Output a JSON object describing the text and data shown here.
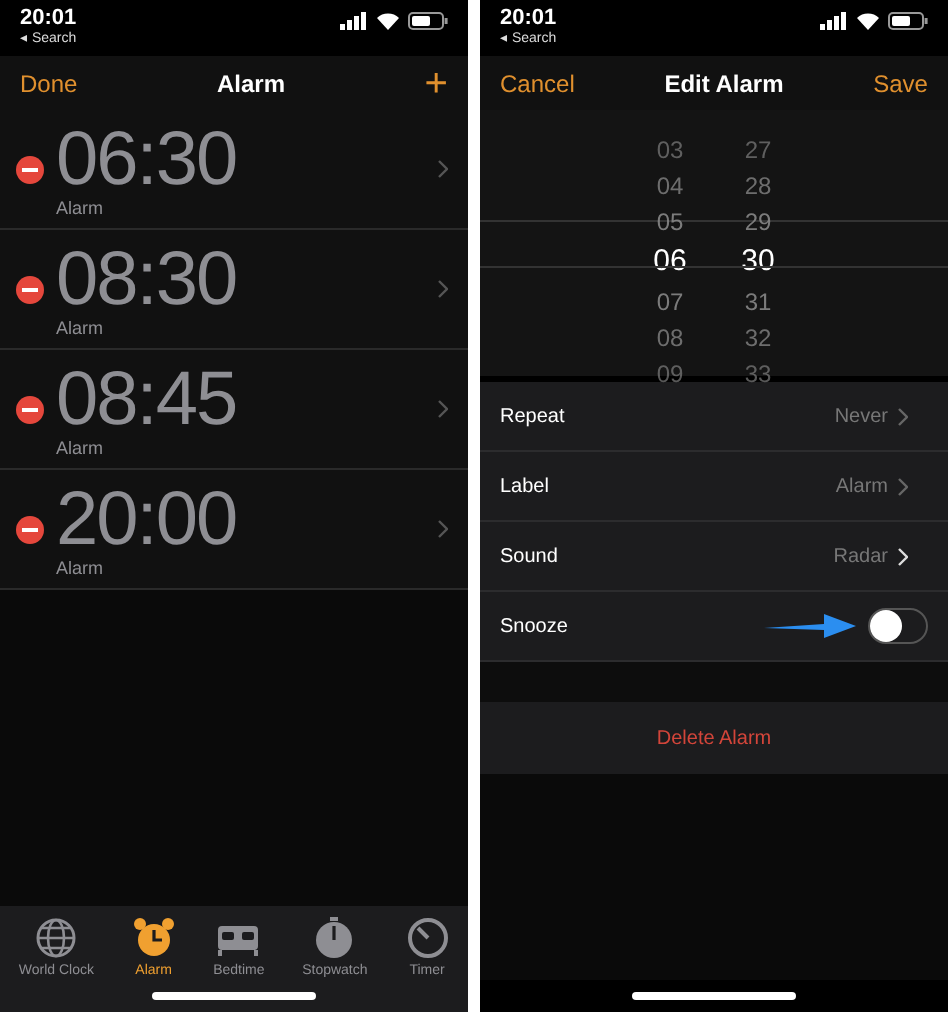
{
  "alarm_list_screen": {
    "status_bar": {
      "time": "20:01",
      "back_label": "◂ Search"
    },
    "nav": {
      "left": "Done",
      "title": "Alarm",
      "right": "+"
    },
    "alarms": [
      {
        "time": "06:30",
        "label": "Alarm"
      },
      {
        "time": "08:30",
        "label": "Alarm"
      },
      {
        "time": "08:45",
        "label": "Alarm"
      },
      {
        "time": "20:00",
        "label": "Alarm"
      }
    ],
    "tabs": [
      {
        "label": "World Clock",
        "selected": false
      },
      {
        "label": "Alarm",
        "selected": true
      },
      {
        "label": "Bedtime",
        "selected": false
      },
      {
        "label": "Stopwatch",
        "selected": false
      },
      {
        "label": "Timer",
        "selected": false
      }
    ]
  },
  "edit_alarm_screen": {
    "status_bar": {
      "time": "20:01",
      "back_label": "◂ Search"
    },
    "nav": {
      "left": "Cancel",
      "title": "Edit Alarm",
      "right": "Save"
    },
    "picker": {
      "hours": [
        {
          "value": "03",
          "selected": false
        },
        {
          "value": "04",
          "selected": false
        },
        {
          "value": "05",
          "selected": false
        },
        {
          "value": "06",
          "selected": true
        },
        {
          "value": "07",
          "selected": false
        },
        {
          "value": "08",
          "selected": false
        },
        {
          "value": "09",
          "selected": false
        }
      ],
      "minutes": [
        {
          "value": "27",
          "selected": false
        },
        {
          "value": "28",
          "selected": false
        },
        {
          "value": "29",
          "selected": false
        },
        {
          "value": "30",
          "selected": true
        },
        {
          "value": "31",
          "selected": false
        },
        {
          "value": "32",
          "selected": false
        },
        {
          "value": "33",
          "selected": false
        }
      ]
    },
    "settings": [
      {
        "kind": "link",
        "label": "Repeat",
        "value": "Never"
      },
      {
        "kind": "link",
        "label": "Label",
        "value": "Alarm"
      },
      {
        "kind": "link",
        "label": "Sound",
        "value": "Radar"
      },
      {
        "kind": "toggle",
        "label": "Snooze",
        "on": false
      }
    ],
    "delete_button": "Delete Alarm"
  }
}
